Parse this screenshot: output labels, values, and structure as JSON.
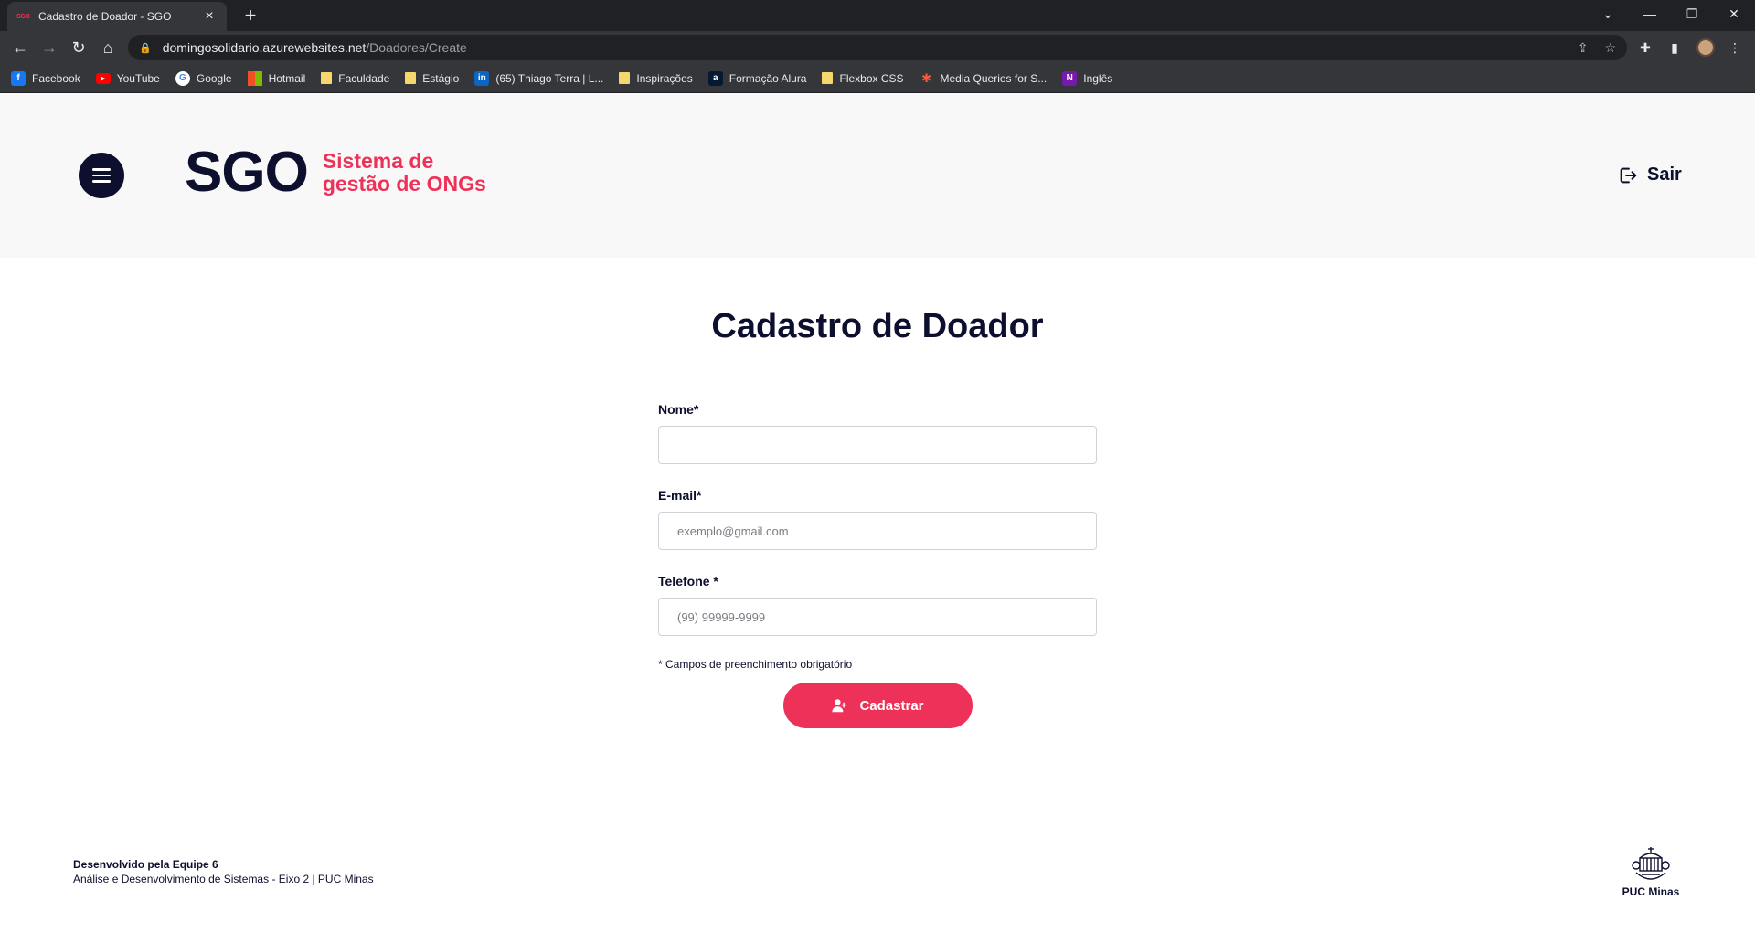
{
  "browser": {
    "tab": {
      "favicon_text": "SGO",
      "title": "Cadastro de Doador - SGO"
    },
    "url": {
      "host": "domingosolidario.azurewebsites.net",
      "path": "/Doadores/Create"
    },
    "bookmarks": [
      {
        "label": "Facebook",
        "icon": "facebook-icon",
        "color": "#1877f2",
        "glyph": "f"
      },
      {
        "label": "YouTube",
        "icon": "youtube-icon",
        "color": "#ff0000",
        "glyph": "▶"
      },
      {
        "label": "Google",
        "icon": "google-icon",
        "color": "#ffffff",
        "glyph": "G"
      },
      {
        "label": "Hotmail",
        "icon": "microsoft-icon",
        "color": "#f25022",
        "glyph": ""
      },
      {
        "label": "Faculdade",
        "icon": "folder-icon",
        "color": "#f5d76e",
        "glyph": ""
      },
      {
        "label": "Estágio",
        "icon": "folder-icon",
        "color": "#f5d76e",
        "glyph": ""
      },
      {
        "label": "(65) Thiago Terra | L...",
        "icon": "linkedin-icon",
        "color": "#0a66c2",
        "glyph": "in"
      },
      {
        "label": "Inspirações",
        "icon": "folder-icon",
        "color": "#f5d76e",
        "glyph": ""
      },
      {
        "label": "Formação Alura",
        "icon": "alura-icon",
        "color": "#051933",
        "glyph": "a"
      },
      {
        "label": "Flexbox CSS",
        "icon": "folder-icon",
        "color": "#f5d76e",
        "glyph": ""
      },
      {
        "label": "Media Queries for S...",
        "icon": "asterisk-icon",
        "color": "#35363a",
        "glyph": "✱"
      },
      {
        "label": "Inglês",
        "icon": "onenote-icon",
        "color": "#7719aa",
        "glyph": "N"
      }
    ]
  },
  "header": {
    "logo_text": "SGO",
    "logo_tagline": "Sistema de gestão de ONGs",
    "logout_label": "Sair"
  },
  "main": {
    "title": "Cadastro de Doador",
    "form": {
      "name_label": "Nome*",
      "name_value": "",
      "email_label": "E-mail*",
      "email_placeholder": "exemplo@gmail.com",
      "phone_label": "Telefone *",
      "phone_placeholder": "(99) 99999-9999",
      "required_note": "* Campos de preenchimento obrigatório",
      "submit_label": "Cadastrar"
    }
  },
  "footer": {
    "credit": "Desenvolvido pela Equipe 6",
    "course": "Análise e Desenvolvimento de Sistemas - Eixo 2 | PUC Minas",
    "logo_label": "PUC Minas"
  },
  "colors": {
    "brand_dark": "#0d0f2e",
    "brand_accent": "#ee3158",
    "header_bg": "#f8f8f8"
  }
}
